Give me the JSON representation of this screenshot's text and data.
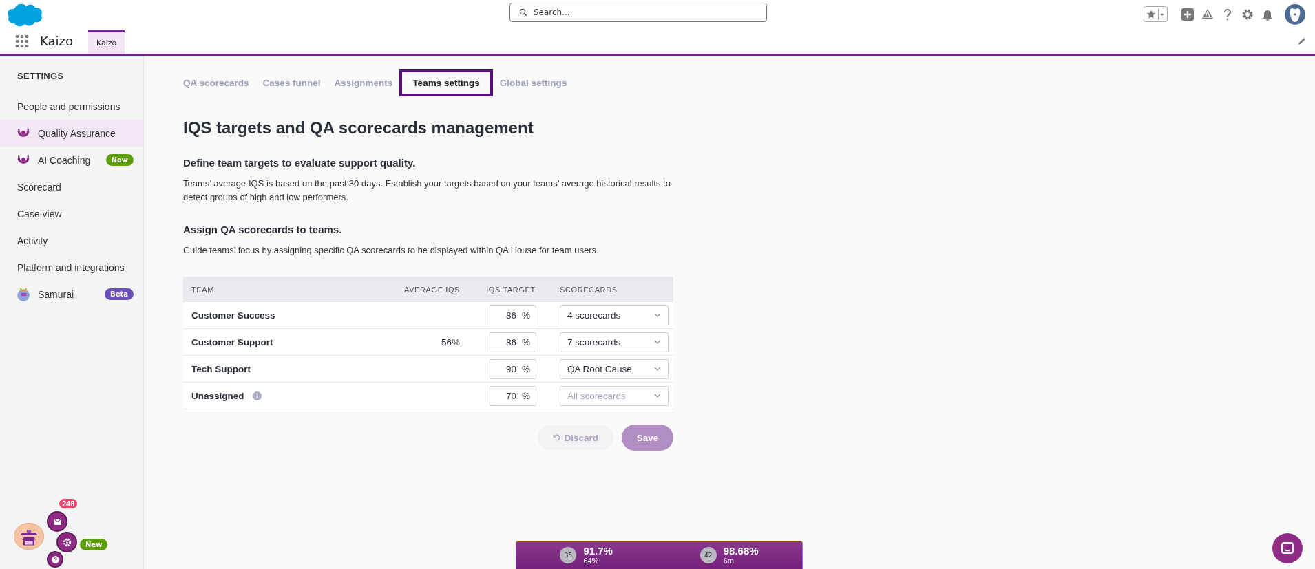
{
  "header": {
    "search": {
      "placeholder": "Search..."
    }
  },
  "nav": {
    "app_name": "Kaizo",
    "tabs": [
      {
        "label": "Kaizo",
        "selected": true
      }
    ]
  },
  "sidebar": {
    "title": "SETTINGS",
    "items": [
      {
        "label": "People and permissions",
        "selected": false,
        "kind": "plain"
      },
      {
        "label": "Quality Assurance",
        "selected": true,
        "kind": "product"
      },
      {
        "label": "AI Coaching",
        "selected": false,
        "kind": "product",
        "badge": {
          "text": "New",
          "color": "#5c9e0b"
        }
      },
      {
        "label": "Scorecard",
        "selected": false,
        "kind": "plain"
      },
      {
        "label": "Case view",
        "selected": false,
        "kind": "plain"
      },
      {
        "label": "Activity",
        "selected": false,
        "kind": "plain"
      },
      {
        "label": "Platform and integrations",
        "selected": false,
        "kind": "plain"
      },
      {
        "label": "Samurai",
        "selected": false,
        "kind": "assistant",
        "badge": {
          "text": "Beta",
          "color": "#6b4fbb"
        }
      }
    ]
  },
  "widget": {
    "count": "248",
    "badge": "New"
  },
  "tabs": [
    {
      "label": "QA scorecards",
      "selected": false
    },
    {
      "label": "Cases funnel",
      "selected": false
    },
    {
      "label": "Assignments",
      "selected": false
    },
    {
      "label": "Teams settings",
      "selected": true
    },
    {
      "label": "Global settings",
      "selected": false
    }
  ],
  "title": "IQS targets and QA scorecards management",
  "sections": [
    {
      "heading": "Define team targets to evaluate support quality.",
      "text": "Teams’ average IQS is based on the past 30 days. Establish your targets based on your teams’ average historical results to detect groups of high and low performers."
    },
    {
      "heading": "Assign QA scorecards to teams.",
      "text": "Guide teams’ focus by assigning specific QA scorecards to be displayed within QA House for team users."
    }
  ],
  "table": {
    "columns": [
      "TEAM",
      "AVERAGE IQS",
      "IQS TARGET",
      "SCORECARDS"
    ],
    "rows": [
      {
        "team": "Customer Success",
        "target": "86",
        "unit": "%",
        "scorecards": "4 scorecards",
        "info": false
      },
      {
        "team": "Customer Support",
        "average": "56%",
        "target": "86",
        "unit": "%",
        "scorecards": "7 scorecards",
        "info": false
      },
      {
        "team": "Tech Support",
        "target": "90",
        "unit": "%",
        "scorecards": "QA Root Cause",
        "info": false
      },
      {
        "team": "Unassigned",
        "target": "70",
        "unit": "%",
        "placeholder": "All scorecards",
        "info": true
      }
    ]
  },
  "buttons": [
    {
      "label": "Discard",
      "kind": "secondary",
      "disabled": true
    },
    {
      "label": "Save",
      "kind": "primary",
      "disabled": true
    }
  ],
  "status_bar": {
    "stats": [
      {
        "rank": "35",
        "value": "91.7%",
        "sub": "64%"
      },
      {
        "rank": "42",
        "value": "98.68%",
        "sub": "6m"
      }
    ]
  }
}
